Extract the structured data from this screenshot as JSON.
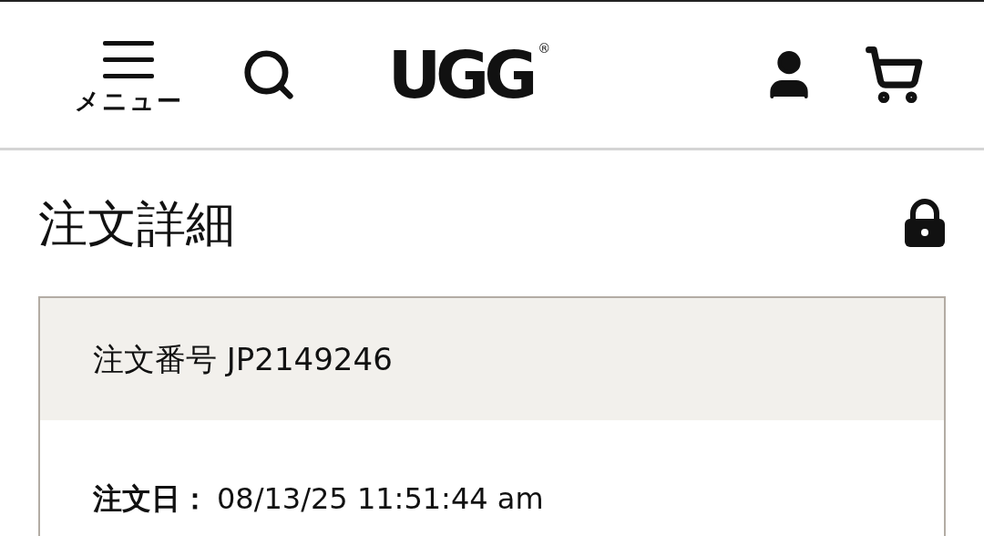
{
  "header": {
    "menu_label": "メニュー",
    "logo": "UGG",
    "logo_mark": "®"
  },
  "page": {
    "title": "注文詳細"
  },
  "order": {
    "number_label": "注文番号 JP2149246",
    "date_label": "注文日：",
    "date_value": "08/13/25 11:51:44 am"
  }
}
